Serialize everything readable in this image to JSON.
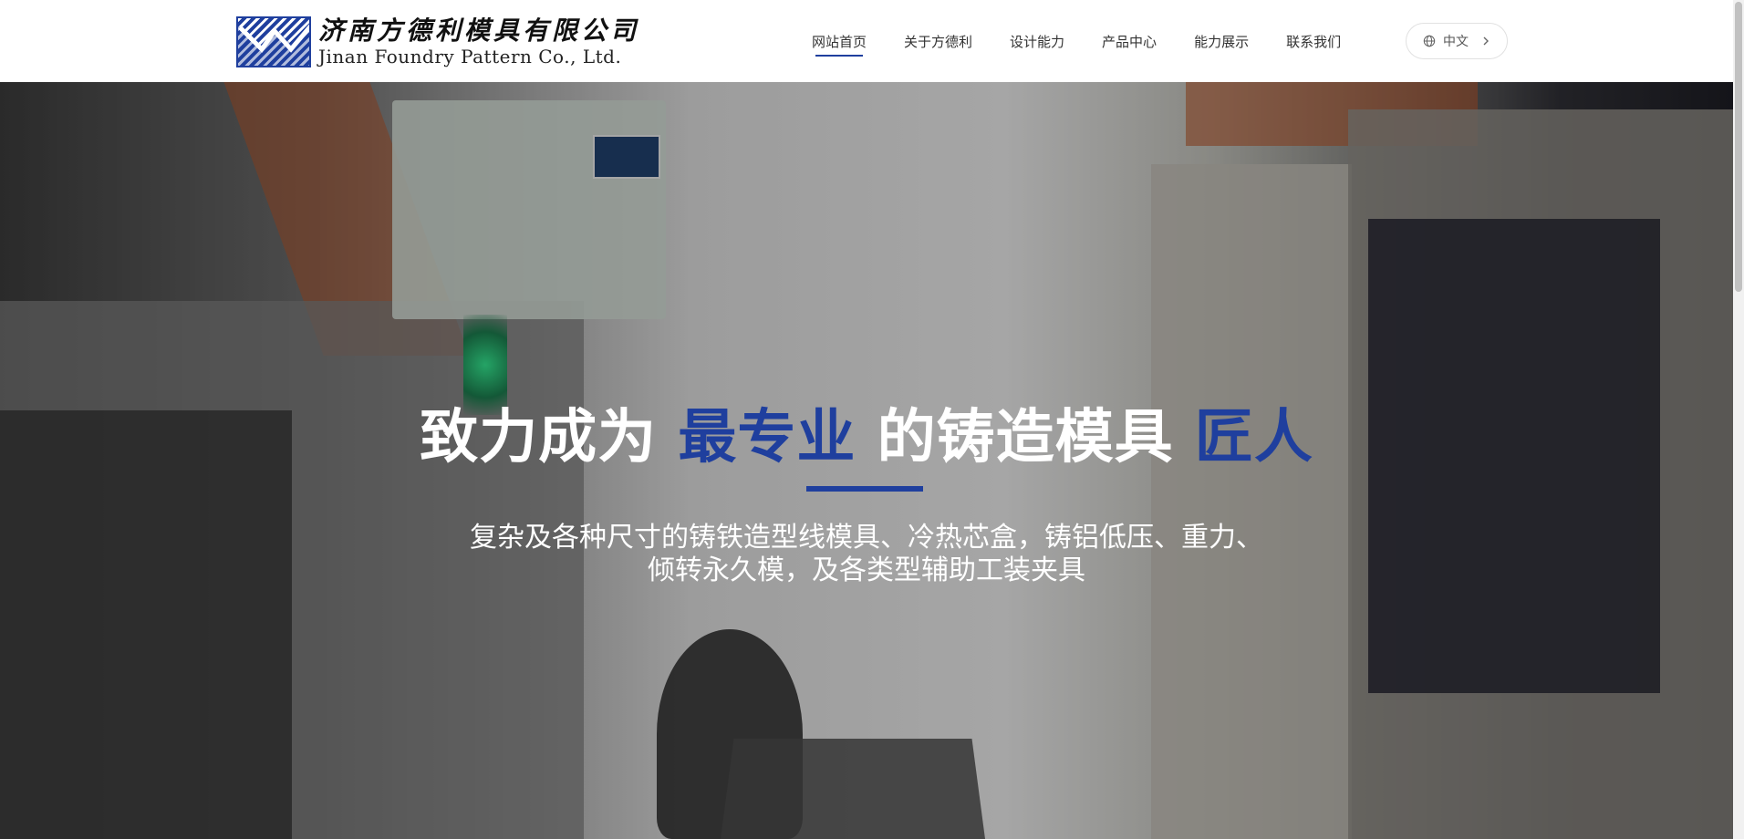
{
  "brand": {
    "name_cn": "济南方德利模具有限公司",
    "name_en": "Jinan Foundry Pattern Co., Ltd."
  },
  "nav": {
    "items": [
      {
        "label": "网站首页",
        "active": true
      },
      {
        "label": "关于方德利",
        "active": false
      },
      {
        "label": "设计能力",
        "active": false
      },
      {
        "label": "产品中心",
        "active": false
      },
      {
        "label": "能力展示",
        "active": false
      },
      {
        "label": "联系我们",
        "active": false
      }
    ]
  },
  "language": {
    "label": "中文",
    "icon": "globe-icon"
  },
  "hero": {
    "headline_part1": "致力成为",
    "headline_accent1": "最专业",
    "headline_part2": "的铸造模具",
    "headline_accent2": "匠人",
    "subline_1": "复杂及各种尺寸的铸铁造型线模具、冷热芯盒，铸铝低压、重力、",
    "subline_2": "倾转永久模，及各类型辅助工装夹具"
  },
  "colors": {
    "accent": "#1f3f9e",
    "text": "#333333",
    "white": "#ffffff"
  }
}
